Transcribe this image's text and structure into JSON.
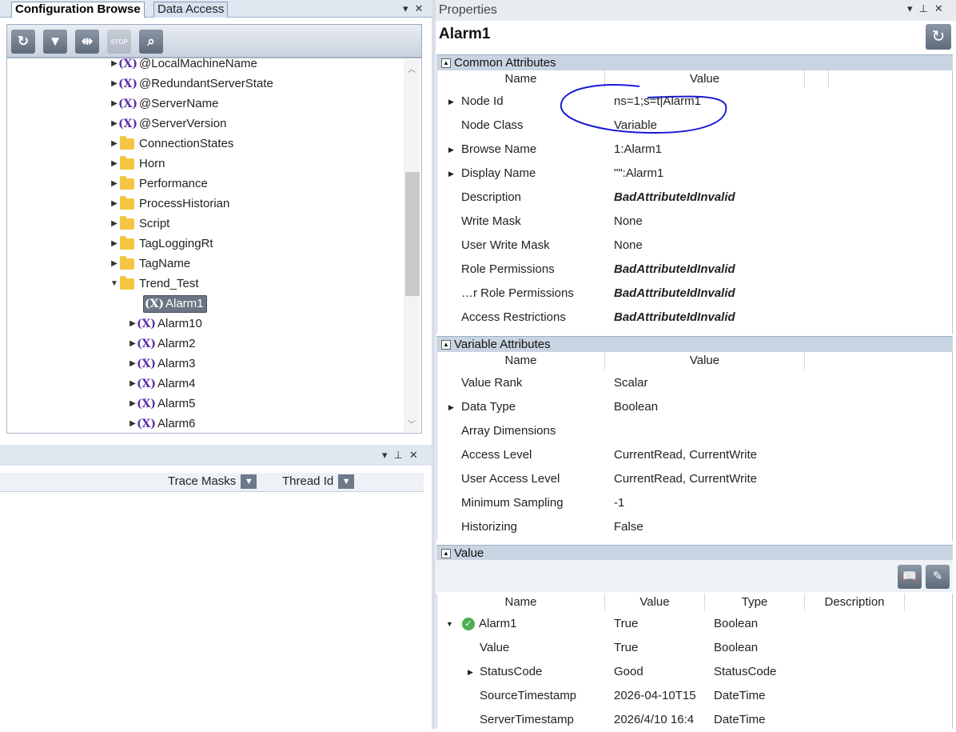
{
  "left_panel": {
    "tabs": [
      "Configuration Browse",
      "Data Access"
    ],
    "tree": [
      {
        "label": "@LocalMachineName",
        "type": "variable",
        "expanded": false
      },
      {
        "label": "@RedundantServerState",
        "type": "variable",
        "expanded": false
      },
      {
        "label": "@ServerName",
        "type": "variable",
        "expanded": false
      },
      {
        "label": "@ServerVersion",
        "type": "variable",
        "expanded": false
      },
      {
        "label": "ConnectionStates",
        "type": "folder",
        "expanded": false
      },
      {
        "label": "Horn",
        "type": "folder",
        "expanded": false
      },
      {
        "label": "Performance",
        "type": "folder",
        "expanded": false
      },
      {
        "label": "ProcessHistorian",
        "type": "folder",
        "expanded": false
      },
      {
        "label": "Script",
        "type": "folder",
        "expanded": false
      },
      {
        "label": "TagLoggingRt",
        "type": "folder",
        "expanded": false
      },
      {
        "label": "TagName",
        "type": "folder",
        "expanded": false
      },
      {
        "label": "Trend_Test",
        "type": "folder",
        "expanded": true
      },
      {
        "label": "Alarm1",
        "type": "variable",
        "selected": true
      },
      {
        "label": "Alarm10",
        "type": "variable"
      },
      {
        "label": "Alarm2",
        "type": "variable"
      },
      {
        "label": "Alarm3",
        "type": "variable"
      },
      {
        "label": "Alarm4",
        "type": "variable"
      },
      {
        "label": "Alarm5",
        "type": "variable"
      },
      {
        "label": "Alarm6",
        "type": "variable"
      }
    ],
    "lower_columns": [
      "Trace Masks",
      "Thread Id"
    ]
  },
  "properties": {
    "header": "Properties",
    "title": "Alarm1",
    "common_header": "Common Attributes",
    "col_name": "Name",
    "col_value": "Value",
    "common": [
      {
        "name": "Node Id",
        "value": "ns=1;s=t|Alarm1",
        "expandable": true
      },
      {
        "name": "Node Class",
        "value": "Variable"
      },
      {
        "name": "Browse Name",
        "value": "1:Alarm1",
        "expandable": true
      },
      {
        "name": "Display Name",
        "value": "\"\":Alarm1",
        "expandable": true
      },
      {
        "name": "Description",
        "value": "BadAttributeIdInvalid",
        "bold": true
      },
      {
        "name": "Write Mask",
        "value": "None"
      },
      {
        "name": "User Write Mask",
        "value": "None"
      },
      {
        "name": "Role Permissions",
        "value": "BadAttributeIdInvalid",
        "bold": true
      },
      {
        "name": "…r Role Permissions",
        "value": "BadAttributeIdInvalid",
        "bold": true
      },
      {
        "name": "Access Restrictions",
        "value": "BadAttributeIdInvalid",
        "bold": true
      }
    ],
    "variable_header": "Variable Attributes",
    "variable": [
      {
        "name": "Value Rank",
        "value": "Scalar"
      },
      {
        "name": "Data Type",
        "value": "Boolean",
        "expandable": true
      },
      {
        "name": "Array Dimensions",
        "value": ""
      },
      {
        "name": "Access Level",
        "value": "CurrentRead, CurrentWrite"
      },
      {
        "name": "User Access Level",
        "value": "CurrentRead, CurrentWrite"
      },
      {
        "name": "Minimum Sampling",
        "value": "-1"
      },
      {
        "name": "Historizing",
        "value": "False"
      }
    ],
    "value_header": "Value",
    "value_columns": [
      "Name",
      "Value",
      "Type",
      "Description"
    ],
    "value_rows": [
      {
        "name": "Alarm1",
        "value": "True",
        "type": "Boolean",
        "level": 0
      },
      {
        "name": "Value",
        "value": "True",
        "type": "Boolean",
        "level": 1
      },
      {
        "name": "StatusCode",
        "value": "Good",
        "type": "StatusCode",
        "level": 1
      },
      {
        "name": "SourceTimestamp",
        "value": "2026-04-10T15",
        "type": "DateTime",
        "level": 1
      },
      {
        "name": "ServerTimestamp",
        "value": "2026/4/10 16:4",
        "type": "DateTime",
        "level": 1
      }
    ]
  },
  "colors": {
    "annotation": "#1a1ad8",
    "variable_icon": "#5a2fa8",
    "folder": "#f4c542"
  }
}
